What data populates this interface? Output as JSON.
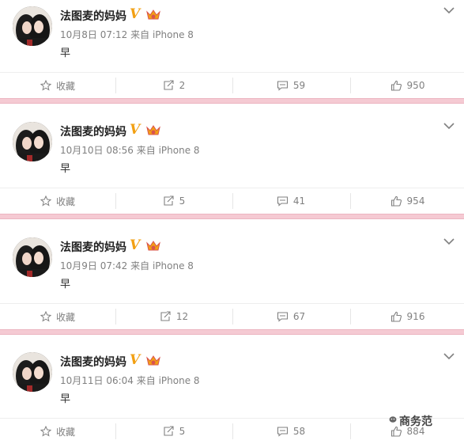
{
  "posts": [
    {
      "username": "法图麦的妈妈",
      "time": "10月8日 07:12",
      "source": "来自 iPhone 8",
      "content": "早",
      "actions": {
        "favorite": "收藏",
        "repost": "2",
        "comment": "59",
        "like": "950"
      }
    },
    {
      "username": "法图麦的妈妈",
      "time": "10月10日 08:56",
      "source": "来自 iPhone 8",
      "content": "早",
      "actions": {
        "favorite": "收藏",
        "repost": "5",
        "comment": "41",
        "like": "954"
      }
    },
    {
      "username": "法图麦的妈妈",
      "time": "10月9日 07:42",
      "source": "来自 iPhone 8",
      "content": "早",
      "actions": {
        "favorite": "收藏",
        "repost": "12",
        "comment": "67",
        "like": "916"
      }
    },
    {
      "username": "法图麦的妈妈",
      "time": "10月11日 06:04",
      "source": "来自 iPhone 8",
      "content": "早",
      "actions": {
        "favorite": "收藏",
        "repost": "5",
        "comment": "58",
        "like": "884"
      }
    }
  ],
  "icons": {
    "verified": "verified-v-icon",
    "vip": "crown-badge-icon",
    "menu": "chevron-down-icon",
    "favorite": "star-icon",
    "repost": "repost-icon",
    "comment": "comment-icon",
    "like": "thumbs-up-icon"
  },
  "colors": {
    "separator": "#f5cad3",
    "verified": "#f2a013",
    "text_muted": "#808080"
  },
  "watermark": "商务范"
}
